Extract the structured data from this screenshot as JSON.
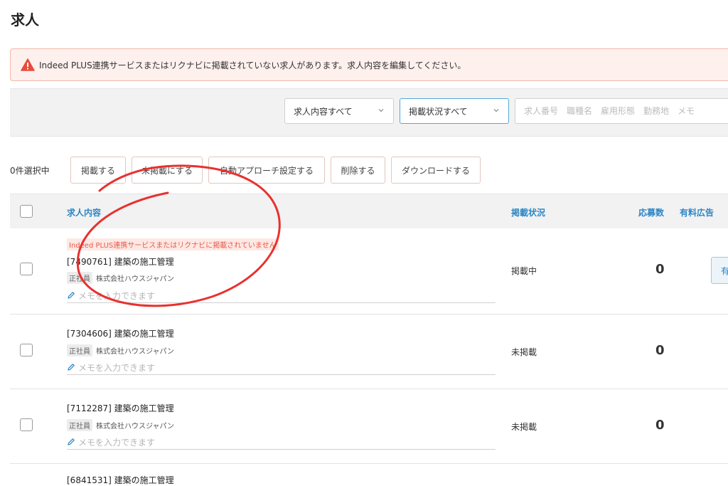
{
  "page": {
    "title": "求人"
  },
  "alert": {
    "text": "Indeed PLUS連携サービスまたはリクナビに掲載されていない求人があります。求人内容を編集してください。",
    "icon": "warning-icon",
    "color": "#e74c3c"
  },
  "filters": {
    "content_select": "求人内容すべて",
    "status_select": "掲載状況すべて",
    "search_placeholder": "求人番号　職種名　雇用形態　勤務地　メモ"
  },
  "actions": {
    "selected_count": "0件選択中",
    "publish": "掲載する",
    "unpublish": "未掲載にする",
    "auto_approach": "自動アプローチ設定する",
    "delete": "削除する",
    "download": "ダウンロードする"
  },
  "table": {
    "headers": {
      "content": "求人内容",
      "status": "掲載状況",
      "applicants": "応募数",
      "paid_ad": "有料広告"
    },
    "rows": [
      {
        "warning": "Indeed PLUS連携サービスまたはリクナビに掲載されていません",
        "title": "[7490761] 建築の施工管理",
        "employment_type": "正社員",
        "company": "株式会社ハウスジャパン",
        "memo_placeholder": "メモを入力できます",
        "status": "掲載中",
        "applicants": "0",
        "paid_button": "有"
      },
      {
        "title": "[7304606] 建築の施工管理",
        "employment_type": "正社員",
        "company": "株式会社ハウスジャパン",
        "memo_placeholder": "メモを入力できます",
        "status": "未掲載",
        "applicants": "0"
      },
      {
        "title": "[7112287] 建築の施工管理",
        "employment_type": "正社員",
        "company": "株式会社ハウスジャパン",
        "memo_placeholder": "メモを入力できます",
        "status": "未掲載",
        "applicants": "0"
      },
      {
        "title": "[6841531] 建築の施工管理"
      }
    ]
  },
  "colors": {
    "accent": "#2c86c5",
    "warning": "#e85a4a",
    "annotation": "#e8312f"
  }
}
